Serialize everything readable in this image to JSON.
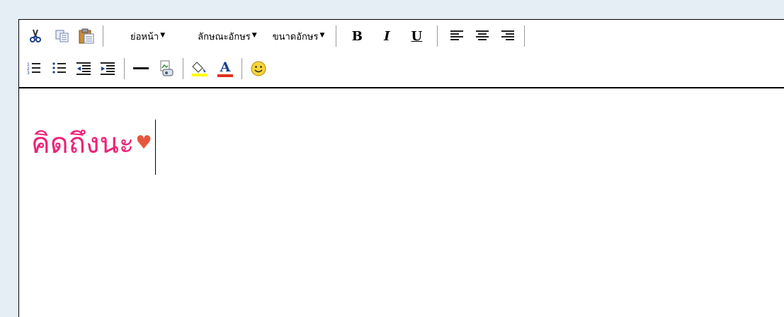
{
  "toolbar": {
    "row1": {
      "cut_icon": "cut-icon",
      "copy_icon": "copy-icon",
      "paste_icon": "paste-icon",
      "paragraph_label": "ย่อหน้า",
      "font_label": "ลักษณะอักษร",
      "size_label": "ขนาดอักษร",
      "bold_label": "B",
      "italic_label": "I",
      "underline_label": "U",
      "align_left_icon": "align-left-icon",
      "align_center_icon": "align-center-icon",
      "align_right_icon": "align-right-icon"
    },
    "row2": {
      "ordered_list_icon": "ordered-list-icon",
      "unordered_list_icon": "unordered-list-icon",
      "outdent_icon": "outdent-icon",
      "indent_icon": "indent-icon",
      "hr_icon": "horizontal-rule-icon",
      "image_icon": "insert-image-icon",
      "highlight_icon": "highlight-color-icon",
      "font_color_label": "A",
      "emoji_icon": "smiley-icon"
    }
  },
  "content": {
    "text": "คิดถึงนะ",
    "heart": "♥"
  },
  "colors": {
    "text": "#ee2277",
    "heart": "#e8563e",
    "highlight_bar": "#ffff00",
    "font_color_bar": "#e0301e"
  }
}
